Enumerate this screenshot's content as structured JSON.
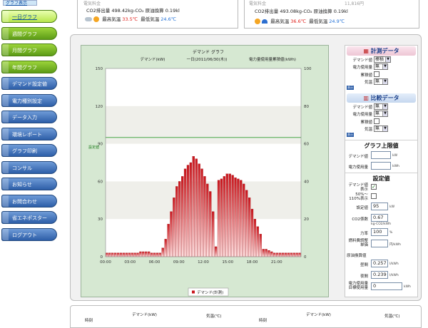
{
  "sidebar": {
    "top_link": "グラフ表示",
    "items": [
      {
        "label": "一日グラフ",
        "style": "green",
        "active": true
      },
      {
        "label": "週間グラフ",
        "style": "green",
        "active": false
      },
      {
        "label": "月間グラフ",
        "style": "green",
        "active": false
      },
      {
        "label": "年間グラフ",
        "style": "green",
        "active": false
      },
      {
        "label": "デマンド設定値",
        "style": "blue",
        "active": false
      },
      {
        "label": "電力種別設定",
        "style": "blue",
        "active": false
      },
      {
        "label": "データ入力",
        "style": "blue",
        "active": false
      },
      {
        "label": "環境レポート",
        "style": "blue",
        "active": false
      },
      {
        "label": "グラフ印刷",
        "style": "blue",
        "active": false
      },
      {
        "label": "コンサル",
        "style": "blue",
        "active": false
      },
      {
        "label": "お知らせ",
        "style": "blue",
        "active": false
      },
      {
        "label": "お問合わせ",
        "style": "blue",
        "active": false
      },
      {
        "label": "省エネポスター",
        "style": "blue",
        "active": false
      },
      {
        "label": "ログアウト",
        "style": "blue",
        "active": false
      }
    ]
  },
  "header": {
    "left": {
      "dim_label": "電気料金",
      "co2_text": "CO2排出量  498.42kg-CO₂   原油換算  0.19kl",
      "max_label": "最高気温",
      "max_value": "33.5℃",
      "min_label": "最低気温",
      "min_value": "24.6℃"
    },
    "right": {
      "dim_label": "電気料金",
      "dim_value": "11,816円",
      "co2_text": "CO2排出量  493.08kg-CO₂   原油換算  0.19kl",
      "max_label": "最高気温",
      "max_value": "36.6℃",
      "min_label": "最低気温",
      "min_value": "24.9℃"
    }
  },
  "chart_data": {
    "type": "bar",
    "title": "デマンド グラフ",
    "subtitle_left": "デマンド(kW)",
    "subtitle_mid": "一日(2011/06/30(木))",
    "subtitle_right": "電力量使用量累積値(kWh)",
    "ylim": [
      0,
      150
    ],
    "y2lim": [
      0,
      100
    ],
    "yticks": [
      "150",
      "120",
      "90",
      "60",
      "30",
      "0"
    ],
    "y2ticks": [
      "100",
      "80",
      "60",
      "40",
      "20",
      "0"
    ],
    "xticks": [
      "00:00",
      "03:00",
      "06:00",
      "09:00",
      "12:00",
      "15:00",
      "18:00",
      "21:00"
    ],
    "setpoint_label": "設定値",
    "setpoint_value": 95,
    "legend": "デマンド(計測)",
    "series": [
      {
        "name": "デマンド(計測)",
        "values": [
          3,
          3,
          3,
          3,
          3,
          3,
          3,
          3,
          3,
          3,
          3,
          3,
          4,
          4,
          4,
          4,
          3,
          3,
          3,
          3,
          7,
          14,
          26,
          36,
          47,
          56,
          60,
          64,
          70,
          73,
          75,
          80,
          78,
          74,
          70,
          64,
          58,
          52,
          36,
          8,
          61,
          62,
          64,
          66,
          66,
          65,
          63,
          62,
          61,
          58,
          53,
          47,
          38,
          30,
          24,
          18,
          6,
          6,
          5,
          4,
          3,
          3,
          3,
          3,
          3,
          3,
          3,
          3,
          3,
          3
        ]
      }
    ]
  },
  "right_panel": {
    "measure_head": "計測データ",
    "compare_head": "比較データ",
    "demand_label": "デマンド値",
    "power_label": "電力使用量",
    "cumulative_label": "累積値",
    "temp_label": "気温",
    "select_bar": "棒積",
    "select_none": "無",
    "hide_link": "表示",
    "graph_limit_title": "グラフ上限値",
    "limit_demand_label": "デマンド値",
    "limit_power_label": "電力使用量",
    "unit_kw": "kW",
    "unit_kwh": "kWh",
    "setting_title": "設定値",
    "demand_show_label": "デマンド値表示",
    "ratio_label": "50%〜110%表示",
    "setpoint_label": "設定値",
    "setpoint_value": "95",
    "co2_label": "CO2係数",
    "co2_value": "0.67",
    "co2_unit": "kg-CO2/kWh",
    "power_factor_label": "力率",
    "power_factor_value": "100",
    "pct_unit": "%",
    "fuel_label": "燃料費調整単価",
    "fuel_unit": "円/kWh",
    "oil_title": "原油換算値",
    "day_label": "昼間",
    "day_value": "0.257",
    "night_label": "夜間",
    "night_value": "0.239",
    "unit_l_kwh": "l/kWh",
    "target_label": "電力使用量目標使用量",
    "target_value": "0",
    "unit_kwh_small": "kWh"
  },
  "bottom_table": {
    "headers": [
      "時刻",
      "デマンド(kW)",
      "気温(℃)",
      "時刻",
      "デマンド(kW)",
      "気温(℃)"
    ]
  }
}
